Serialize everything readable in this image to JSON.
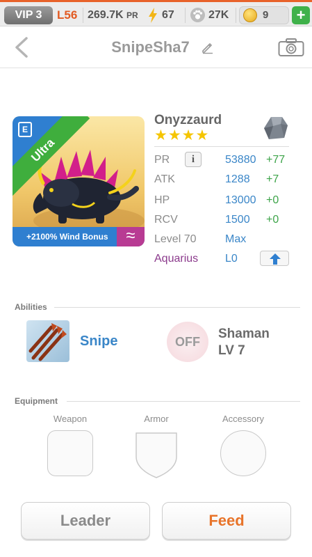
{
  "topbar": {
    "vip": "VIP 3",
    "level": "L56",
    "pr_value": "269.7K",
    "pr_unit": "PR",
    "energy": "67",
    "food": "27K",
    "coins": "9",
    "add": "+"
  },
  "header": {
    "title": "SnipeSha7"
  },
  "monster": {
    "name": "Onyzzaurd",
    "stars": "★★★★",
    "rarity": "Ultra",
    "element_tag": "E",
    "bonus": "+2100% Wind Bonus",
    "element_symbol": "≈",
    "stats": {
      "pr_label": "PR",
      "pr_value": "53880",
      "pr_plus": "+77",
      "info": "i",
      "atk_label": "ATK",
      "atk_value": "1288",
      "atk_plus": "+7",
      "hp_label": "HP",
      "hp_value": "13000",
      "hp_plus": "+0",
      "rcv_label": "RCV",
      "rcv_value": "1500",
      "rcv_plus": "+0",
      "level_label": "Level 70",
      "level_value": "Max",
      "sign_label": "Aquarius",
      "sign_value": "L0"
    }
  },
  "abilities": {
    "header": "Abilities",
    "ability1": "Snipe",
    "ability2_state": "OFF",
    "ability2_name": "Shaman",
    "ability2_level": "LV 7"
  },
  "equipment": {
    "header": "Equipment",
    "weapon": "Weapon",
    "armor": "Armor",
    "accessory": "Accessory"
  },
  "actions": {
    "leader": "Leader",
    "feed": "Feed"
  },
  "colors": {
    "accent_orange": "#e8742a",
    "stat_blue": "#3a86c8",
    "plus_green": "#3ea44a",
    "aquarius_purple": "#8b3a8c"
  }
}
